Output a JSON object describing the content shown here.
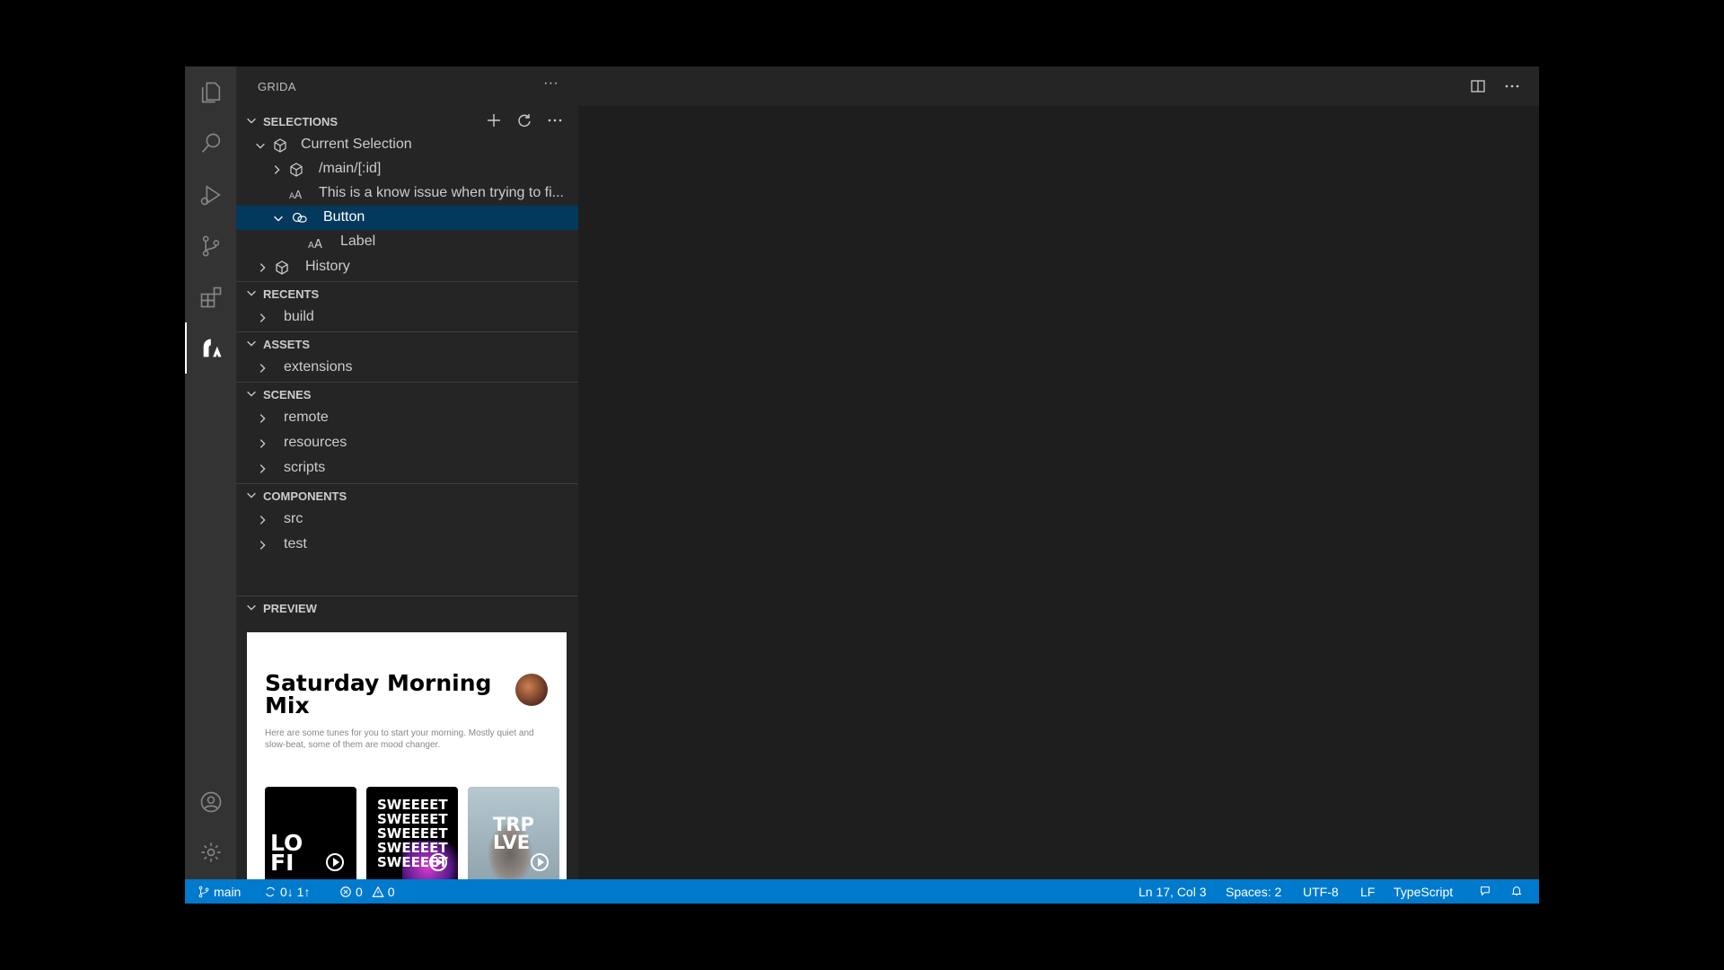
{
  "sidebar": {
    "title": "GRIDA",
    "more": "···",
    "sections": {
      "selections": {
        "label": "SELECTIONS",
        "current": "Current Selection",
        "route": "/main/[:id]",
        "text_item": "This is a know issue when trying to fi...",
        "button": "Button",
        "label_item": "Label",
        "history": "History"
      },
      "recents": {
        "label": "RECENTS",
        "items": [
          "build"
        ]
      },
      "assets": {
        "label": "ASSETS",
        "items": [
          "extensions"
        ]
      },
      "scenes": {
        "label": "SCENES",
        "items": [
          "remote",
          "resources",
          "scripts"
        ]
      },
      "components": {
        "label": "COMPONENTS",
        "items": [
          "src",
          "test"
        ]
      },
      "preview": {
        "label": "PREVIEW"
      }
    },
    "actions_more": "···"
  },
  "preview": {
    "title": "Saturday Morning Mix",
    "description": "Here are some tunes for you to start your morning. Mostly quiet and slow-beat, some of them are mood changer.",
    "tiles": {
      "lofi": "LO FI",
      "sweet": [
        "SWEEEET",
        "SWEEEET",
        "SWEEEET",
        "SWEEEET",
        "SWEEEET"
      ],
      "trip": "TRP LVE"
    }
  },
  "statusbar": {
    "branch": "main",
    "sync": "0↓ 1↑",
    "errors": "0",
    "warnings": "0",
    "position": "Ln 17, Col 3",
    "spaces": "Spaces: 2",
    "encoding": "UTF-8",
    "eol": "LF",
    "language": "TypeScript"
  },
  "colors": {
    "statusbar": "#007acc",
    "selection": "#04395e",
    "activity": "#333333",
    "sidebar": "#252526",
    "editor": "#1e1e1e"
  }
}
